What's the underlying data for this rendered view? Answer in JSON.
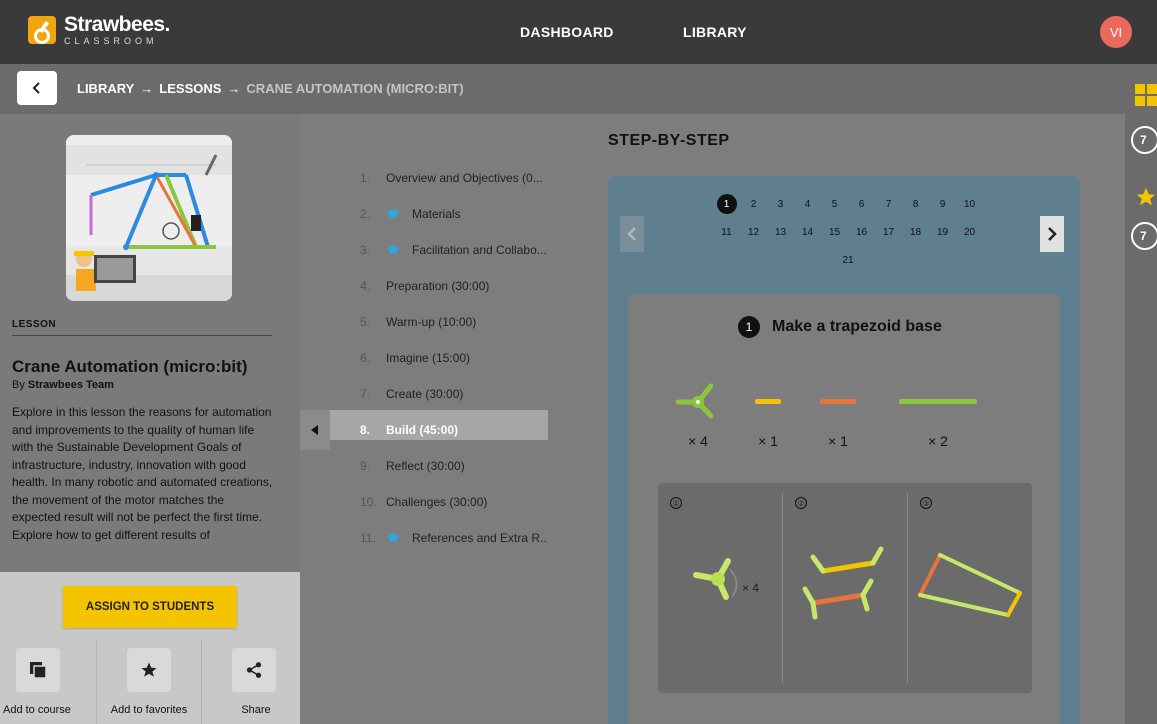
{
  "header": {
    "brand_name": "Strawbees.",
    "brand_sub": "CLASSROOM",
    "nav": [
      "DASHBOARD",
      "LIBRARY"
    ],
    "avatar_initials": "VI"
  },
  "breadcrumb": {
    "items": [
      "LIBRARY",
      "LESSONS",
      "CRANE AUTOMATION (MICRO:BIT)"
    ],
    "separator": "→"
  },
  "lesson": {
    "tag": "LESSON",
    "title": "Crane Automation (micro:bit)",
    "by_prefix": "By",
    "author": "Strawbees Team",
    "description": "Explore in this lesson the reasons for automation and improvements to the quality of human life with the Sustainable Development Goals of infrastructure, industry, innovation with good health. In many robotic and automated creations, the movement of the motor matches the expected result will not be perfect the first time. Explore how to get different results of"
  },
  "footer": {
    "assign_label": "ASSIGN TO STUDENTS",
    "actions": [
      {
        "label": "Add to course",
        "icon": "copy-icon"
      },
      {
        "label": "Add to favorites",
        "icon": "star-icon"
      },
      {
        "label": "Share",
        "icon": "share-icon"
      }
    ]
  },
  "toc": [
    {
      "num": "1.",
      "label": "Overview and Objectives (0...",
      "cap": false
    },
    {
      "num": "2.",
      "label": "Materials",
      "cap": true
    },
    {
      "num": "3.",
      "label": "Facilitation and Collabo...",
      "cap": true
    },
    {
      "num": "4.",
      "label": "Preparation (30:00)",
      "cap": false
    },
    {
      "num": "5.",
      "label": "Warm-up (10:00)",
      "cap": false
    },
    {
      "num": "6.",
      "label": "Imagine (15:00)",
      "cap": false
    },
    {
      "num": "7.",
      "label": "Create (30:00)",
      "cap": false
    },
    {
      "num": "8.",
      "label": "Build (45:00)",
      "cap": false,
      "active": true
    },
    {
      "num": "9.",
      "label": "Reflect (30:00)",
      "cap": false
    },
    {
      "num": "10.",
      "label": "Challenges (30:00)",
      "cap": false
    },
    {
      "num": "11.",
      "label": "References and Extra R...",
      "cap": true
    }
  ],
  "main": {
    "title": "STEP-BY-STEP",
    "pages_row1": [
      "1",
      "2",
      "3",
      "4",
      "5",
      "6",
      "7",
      "8",
      "9",
      "10"
    ],
    "pages_row2": [
      "11",
      "12",
      "13",
      "14",
      "15",
      "16",
      "17",
      "18",
      "19",
      "20"
    ],
    "pages_row3": [
      "21"
    ],
    "current_page": "1",
    "step_number": "1",
    "step_title": "Make a trapezoid base",
    "parts": [
      {
        "qty": "× 4",
        "color": "#8cc63f",
        "kind": "connector"
      },
      {
        "qty": "× 1",
        "color": "#f5c400",
        "kind": "straw-short"
      },
      {
        "qty": "× 1",
        "color": "#e8743b",
        "kind": "straw-medium"
      },
      {
        "qty": "× 2",
        "color": "#8cc63f",
        "kind": "straw-long"
      }
    ],
    "instructions": [
      {
        "num": "①",
        "caption": "× 4"
      },
      {
        "num": "②",
        "caption": ""
      },
      {
        "num": "③",
        "caption": ""
      }
    ]
  },
  "right_strip": {
    "count1": "7",
    "count2": "7"
  }
}
